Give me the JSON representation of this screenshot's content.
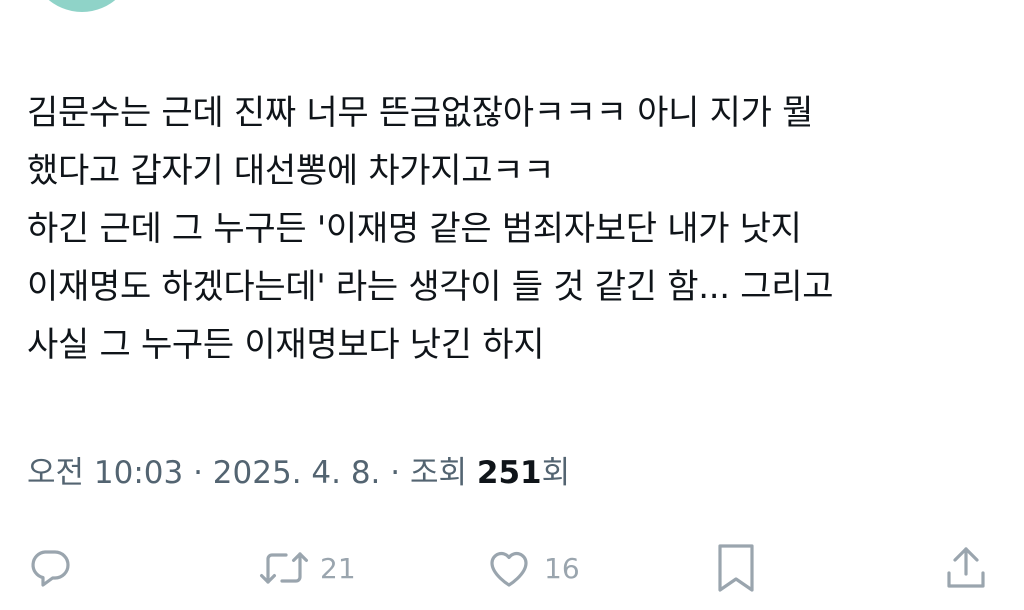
{
  "tweet": {
    "lines": [
      "김문수는 근데 진짜 너무 뜬금없잖아ㅋㅋㅋ 아니 지가 뭘",
      "했다고 갑자기 대선뽕에 차가지고ㅋㅋ",
      "하긴 근데 그 누구든 '이재명 같은 범죄자보단 내가 낫지",
      "이재명도 하겠다는데' 라는 생각이 들 것 같긴 함... 그리고",
      "사실 그 누구든 이재명보다 낫긴 하지"
    ]
  },
  "meta": {
    "time": "오전 10:03",
    "separator": " · ",
    "date": "2025. 4. 8.",
    "views_label": "조회 ",
    "views_count": "251",
    "views_suffix": "회"
  },
  "actions": {
    "reply": {
      "icon": "reply-icon",
      "count": ""
    },
    "retweet": {
      "icon": "retweet-icon",
      "count": "21"
    },
    "like": {
      "icon": "heart-icon",
      "count": "16"
    },
    "bookmark": {
      "icon": "bookmark-icon",
      "count": ""
    },
    "share": {
      "icon": "share-icon",
      "count": ""
    }
  },
  "colors": {
    "text": "#0f1419",
    "secondary": "#536471",
    "action_icon": "#9aa5ae"
  }
}
